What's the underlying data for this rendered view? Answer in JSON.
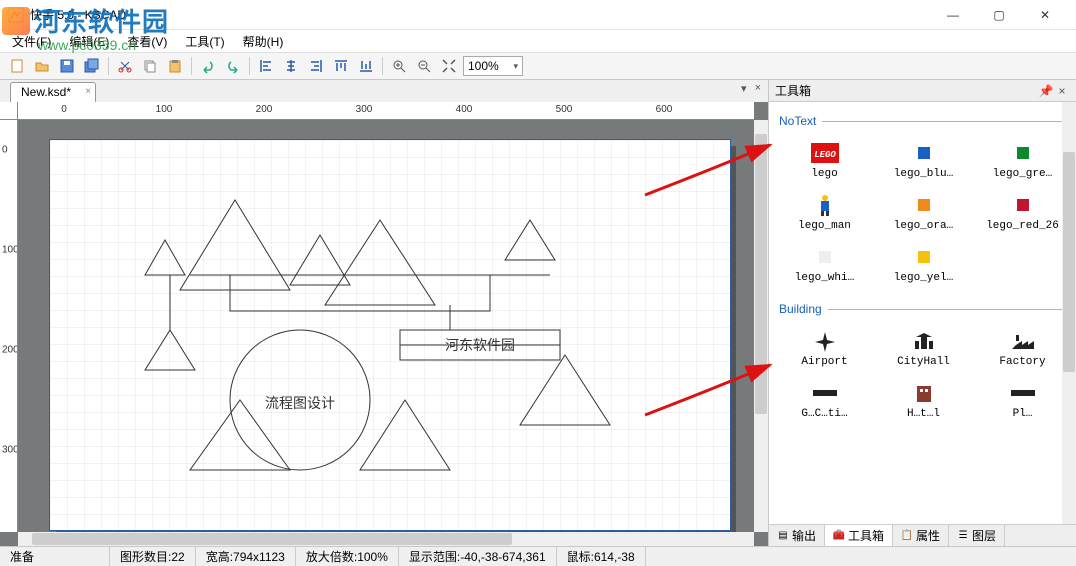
{
  "window": {
    "title": "快手 5.0 - KSCAD"
  },
  "menu": {
    "file": "文件(F)",
    "edit": "编辑(E)",
    "view": "查看(V)",
    "tool": "工具(T)",
    "help": "帮助(H)"
  },
  "toolbar": {
    "zoom": "100%"
  },
  "tab": {
    "name": "New.ksd*"
  },
  "ruler_h": [
    "0",
    "100",
    "200",
    "300",
    "400",
    "500",
    "600"
  ],
  "ruler_v": [
    "0",
    "100",
    "200",
    "300"
  ],
  "canvas_text": {
    "flow": "流程图设计",
    "hd": "河东软件园"
  },
  "toolbox": {
    "title": "工具箱",
    "cat1": "NoText",
    "cat2": "Building",
    "items1": [
      {
        "label": "lego",
        "color": "#d11",
        "type": "lego"
      },
      {
        "label": "lego_blu…",
        "color": "#1860c3",
        "type": "sq"
      },
      {
        "label": "lego_gre…",
        "color": "#0a8a2b",
        "type": "sq"
      },
      {
        "label": "lego_man",
        "color": "#f6a623",
        "type": "man"
      },
      {
        "label": "lego_ora…",
        "color": "#f08a1d",
        "type": "sq"
      },
      {
        "label": "lego_red_26",
        "color": "#c0152f",
        "type": "sq"
      },
      {
        "label": "lego_whi…",
        "color": "#eeeeee",
        "type": "sq"
      },
      {
        "label": "lego_yel…",
        "color": "#f4c20d",
        "type": "sq"
      }
    ],
    "items2": [
      {
        "label": "Airport",
        "type": "airport"
      },
      {
        "label": "CityHall",
        "type": "cityhall"
      },
      {
        "label": "Factory",
        "type": "factory"
      },
      {
        "label": "G…C…ti…",
        "type": "gen"
      },
      {
        "label": "H…t…l",
        "type": "hotel"
      },
      {
        "label": "Pl…",
        "type": "gen"
      }
    ],
    "tabs": {
      "output": "输出",
      "toolbox": "工具箱",
      "props": "属性",
      "layers": "图层"
    }
  },
  "status": {
    "ready": "准备",
    "count": "图形数目:22",
    "size": "宽高:794x1123",
    "zoom": "放大倍数:100%",
    "range": "显示范围:-40,-38-674,361",
    "mouse": "鼠标:614,-38"
  },
  "watermark": {
    "name": "河东软件园",
    "url": "www.pc0359.cn"
  }
}
